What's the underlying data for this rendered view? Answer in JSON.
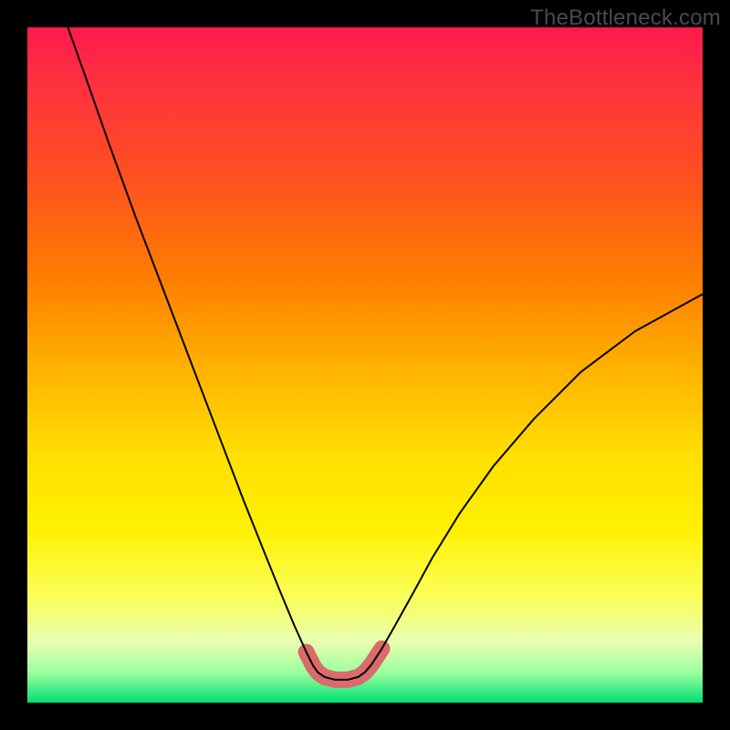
{
  "watermark": "TheBottleneck.com",
  "chart_data": {
    "type": "line",
    "title": "",
    "xlabel": "",
    "ylabel": "",
    "xlim": [
      0,
      100
    ],
    "ylim": [
      0,
      100
    ],
    "gradient_stops": [
      {
        "pos": 0,
        "color": "#ff1a4d"
      },
      {
        "pos": 8,
        "color": "#ff3040"
      },
      {
        "pos": 22,
        "color": "#ff5020"
      },
      {
        "pos": 38,
        "color": "#ff8000"
      },
      {
        "pos": 50,
        "color": "#ffb000"
      },
      {
        "pos": 64,
        "color": "#ffe000"
      },
      {
        "pos": 74,
        "color": "#fff000"
      },
      {
        "pos": 84,
        "color": "#fbff55"
      },
      {
        "pos": 91,
        "color": "#e8ffb0"
      },
      {
        "pos": 95.5,
        "color": "#9cffa0"
      },
      {
        "pos": 100,
        "color": "#00e070"
      }
    ],
    "series": [
      {
        "name": "bottleneck-curve",
        "color": "#000000",
        "stroke_width": 2,
        "points": [
          {
            "x": 6.0,
            "y": 100.0
          },
          {
            "x": 8.5,
            "y": 93.0
          },
          {
            "x": 12.0,
            "y": 83.0
          },
          {
            "x": 16.0,
            "y": 72.0
          },
          {
            "x": 20.0,
            "y": 61.5
          },
          {
            "x": 24.0,
            "y": 51.0
          },
          {
            "x": 28.0,
            "y": 40.5
          },
          {
            "x": 32.0,
            "y": 30.0
          },
          {
            "x": 35.0,
            "y": 22.5
          },
          {
            "x": 37.5,
            "y": 16.3
          },
          {
            "x": 39.5,
            "y": 11.5
          },
          {
            "x": 41.3,
            "y": 7.5
          },
          {
            "x": 42.3,
            "y": 5.5
          },
          {
            "x": 43.0,
            "y": 4.5
          },
          {
            "x": 44.0,
            "y": 3.8
          },
          {
            "x": 45.5,
            "y": 3.4
          },
          {
            "x": 47.5,
            "y": 3.4
          },
          {
            "x": 49.0,
            "y": 3.8
          },
          {
            "x": 50.0,
            "y": 4.5
          },
          {
            "x": 51.0,
            "y": 5.7
          },
          {
            "x": 52.5,
            "y": 8.0
          },
          {
            "x": 54.5,
            "y": 11.5
          },
          {
            "x": 57.0,
            "y": 16.0
          },
          {
            "x": 60.0,
            "y": 21.5
          },
          {
            "x": 64.0,
            "y": 28.0
          },
          {
            "x": 69.0,
            "y": 35.0
          },
          {
            "x": 75.0,
            "y": 42.0
          },
          {
            "x": 82.0,
            "y": 49.0
          },
          {
            "x": 90.0,
            "y": 55.0
          },
          {
            "x": 100.0,
            "y": 60.5
          }
        ]
      },
      {
        "name": "valley-highlight",
        "color": "#d96b6b",
        "stroke_width": 12,
        "linecap": "round",
        "points": [
          {
            "x": 41.3,
            "y": 7.5
          },
          {
            "x": 42.3,
            "y": 5.5
          },
          {
            "x": 43.0,
            "y": 4.5
          },
          {
            "x": 44.0,
            "y": 3.8
          },
          {
            "x": 45.5,
            "y": 3.4
          },
          {
            "x": 47.5,
            "y": 3.4
          },
          {
            "x": 49.0,
            "y": 3.8
          },
          {
            "x": 50.0,
            "y": 4.5
          },
          {
            "x": 51.0,
            "y": 5.7
          },
          {
            "x": 52.5,
            "y": 8.0
          }
        ]
      }
    ]
  }
}
